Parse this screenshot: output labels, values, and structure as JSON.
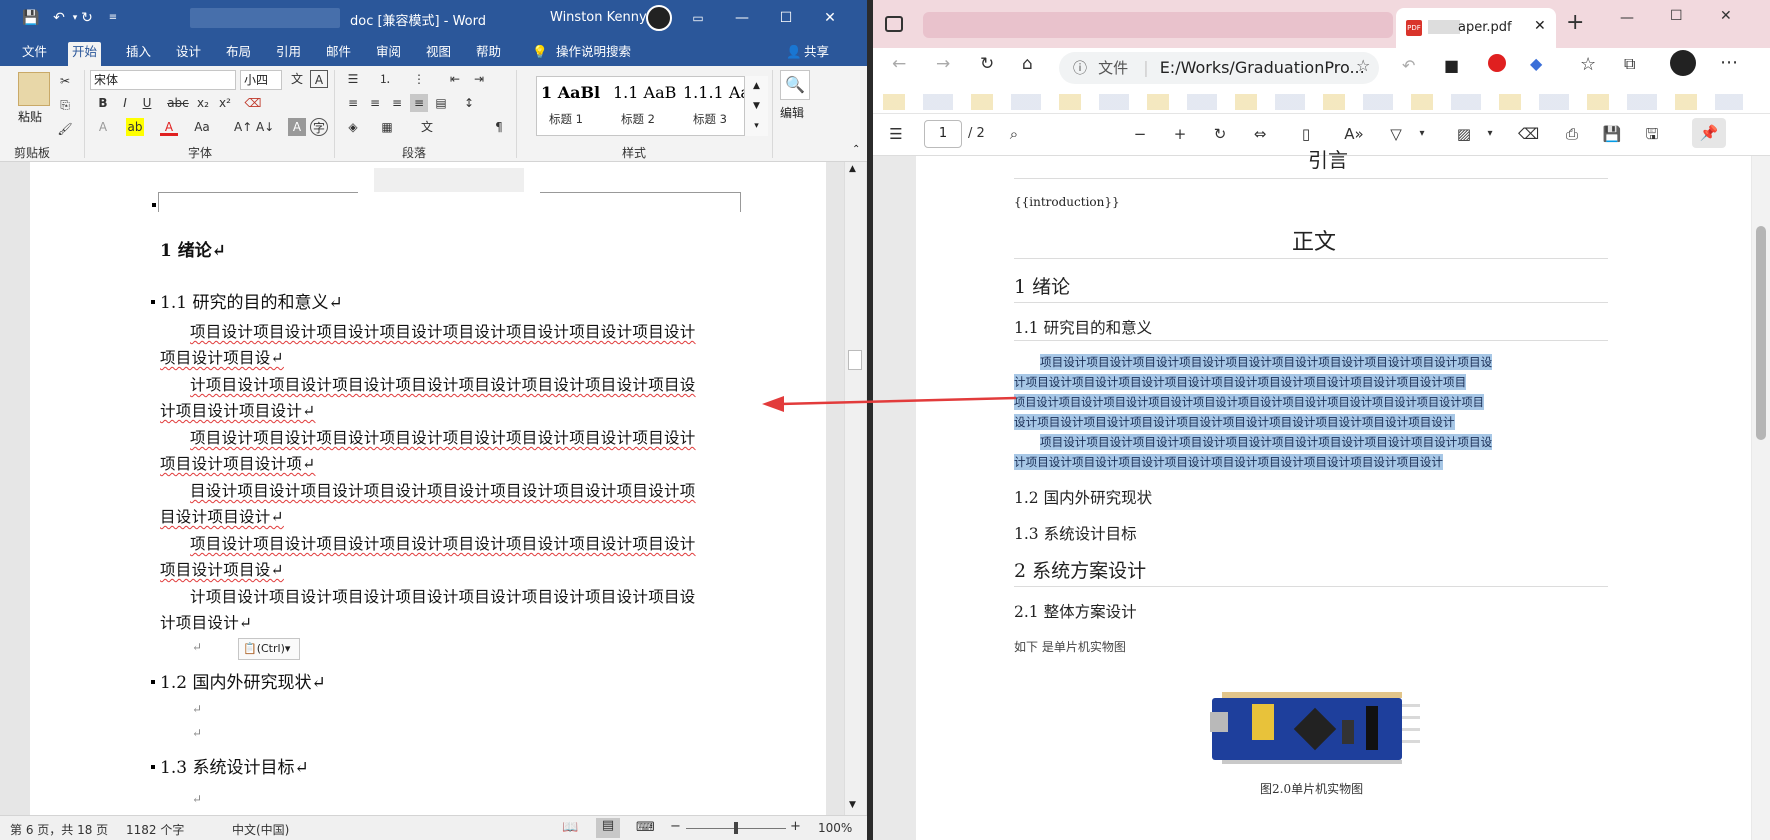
{
  "word": {
    "title": "doc [兼容模式] - Word",
    "user": "Winston Kenny",
    "tabs": [
      "文件",
      "开始",
      "插入",
      "设计",
      "布局",
      "引用",
      "邮件",
      "审阅",
      "视图",
      "帮助"
    ],
    "tell_me": "操作说明搜索",
    "share": "共享",
    "ribbon": {
      "paste": "粘贴",
      "clipboard": "剪贴板",
      "font_name": "宋体",
      "font_size": "小四",
      "font": "字体",
      "paragraph": "段落",
      "styles_label": "样式",
      "styles": [
        {
          "preview": "AaBl",
          "prefix": "1",
          "name": "标题 1"
        },
        {
          "preview": "AaB",
          "prefix": "1.1",
          "name": "标题 2"
        },
        {
          "preview": "Aa",
          "prefix": "1.1.1",
          "name": "标题 3"
        }
      ],
      "editing": "编辑",
      "font_buttons": [
        "B",
        "I",
        "U",
        "abc",
        "x₂",
        "x²"
      ]
    },
    "doc": {
      "h1": "1 绪论↵",
      "h2_1": "1.1 研究的目的和意义↵",
      "para_lines": [
        "项目设计项目设计项目设计项目设计项目设计项目设计项目设计项目设计",
        "项目设计项目设↵",
        "计项目设计项目设计项目设计项目设计项目设计项目设计项目设计项目设",
        "计项目设计项目设计↵",
        "项目设计项目设计项目设计项目设计项目设计项目设计项目设计项目设计",
        "项目设计项目设计项↵",
        "目设计项目设计项目设计项目设计项目设计项目设计项目设计项目设计项",
        "目设计项目设计↵",
        "项目设计项目设计项目设计项目设计项目设计项目设计项目设计项目设计",
        "项目设计项目设↵",
        "计项目设计项目设计项目设计项目设计项目设计项目设计项目设计项目设",
        "计项目设计↵"
      ],
      "paste_ctrl": "(Ctrl)",
      "h2_2": "1.2 国内外研究现状↵",
      "h2_3": "1.3 系统设计目标↵",
      "return_mark": "↵"
    },
    "status": {
      "page": "第 6 页，共 18 页",
      "words": "1182 个字",
      "lang": "中文(中国)",
      "zoom": "100%"
    }
  },
  "browser": {
    "tab_title": "aper.pdf",
    "address_prefix": "文件",
    "address": "E:/Works/GraduationPro...",
    "page_current": "1",
    "page_total": "/ 2",
    "pdf": {
      "top_heading": "引言",
      "placeholder": "{{introduction}}",
      "main_title": "正文",
      "h1": "1 绪论",
      "h2_1": "1.1 研究目的和意义",
      "hl_lines": [
        "项目设计项目设计项目设计项目设计项目设计项目设计项目设计项目设计项目设计项目设",
        "计项目设计项目设计项目设计项目设计项目设计项目设计项目设计项目设计项目设计项目",
        "项目设计项目设计项目设计项目设计项目设计项目设计项目设计项目设计项目设计项目设计项目",
        "设计项目设计项目设计项目设计项目设计项目设计项目设计项目设计项目设计项目设计",
        "项目设计项目设计项目设计项目设计项目设计项目设计项目设计项目设计项目设计项目设",
        "计项目设计项目设计项目设计项目设计项目设计项目设计项目设计项目设计项目设计"
      ],
      "h2_2": "1.2 国内外研究现状",
      "h2_3": "1.3 系统设计目标",
      "h1_2": "2 系统方案设计",
      "h2_4": "2.1 整体方案设计",
      "body": "如下 是单片机实物图",
      "caption": "图2.0单片机实物图"
    }
  }
}
